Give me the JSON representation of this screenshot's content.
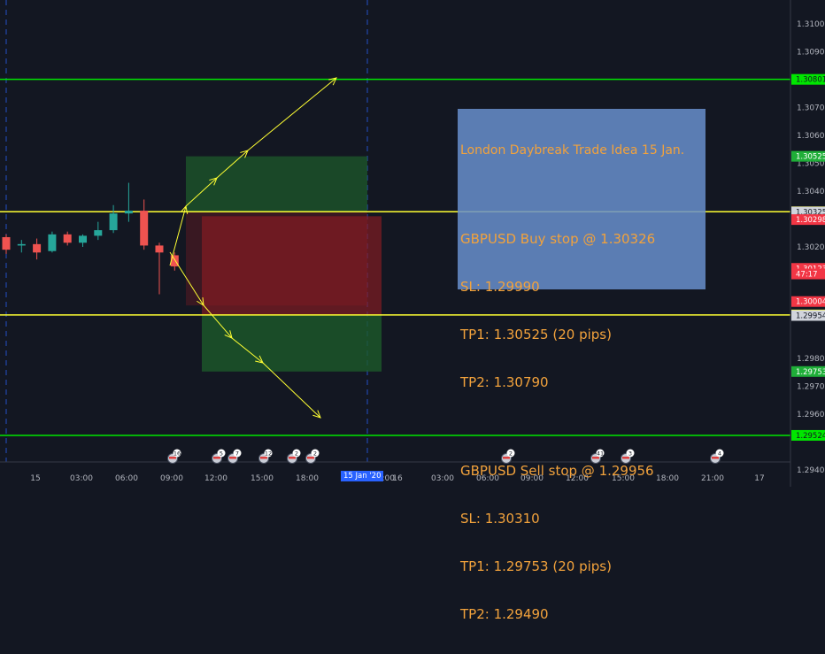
{
  "chart_data": {
    "type": "candlestick",
    "symbol": "GBPUSD",
    "ylim": [
      1.2935,
      1.312
    ],
    "y_ticks": [
      "1.31000",
      "1.30900",
      "1.30700",
      "1.30600",
      "1.30500",
      "1.30400",
      "1.30200",
      "1.29800",
      "1.29700",
      "1.29600",
      "1.29400"
    ],
    "x_ticks": [
      "15",
      "03:00",
      "06:00",
      "09:00",
      "12:00",
      "15:00",
      "18:00",
      "15 Jan '20",
      "22:00",
      "16",
      "03:00",
      "06:00",
      "09:00",
      "12:00",
      "15:00",
      "18:00",
      "21:00",
      "17"
    ],
    "candles": [
      {
        "t": 0,
        "o": 1.30235,
        "h": 1.30245,
        "l": 1.30175,
        "c": 1.3019
      },
      {
        "t": 1,
        "o": 1.30205,
        "h": 1.30225,
        "l": 1.3018,
        "c": 1.3021
      },
      {
        "t": 2,
        "o": 1.3021,
        "h": 1.3023,
        "l": 1.30155,
        "c": 1.3018
      },
      {
        "t": 3,
        "o": 1.30185,
        "h": 1.30255,
        "l": 1.3018,
        "c": 1.30245
      },
      {
        "t": 4,
        "o": 1.30245,
        "h": 1.30255,
        "l": 1.30205,
        "c": 1.30215
      },
      {
        "t": 5,
        "o": 1.30215,
        "h": 1.30245,
        "l": 1.302,
        "c": 1.3024
      },
      {
        "t": 6,
        "o": 1.3024,
        "h": 1.3029,
        "l": 1.30225,
        "c": 1.3026
      },
      {
        "t": 7,
        "o": 1.3026,
        "h": 1.3035,
        "l": 1.3025,
        "c": 1.3032
      },
      {
        "t": 8,
        "o": 1.3032,
        "h": 1.3043,
        "l": 1.3029,
        "c": 1.3033
      },
      {
        "t": 9,
        "o": 1.3033,
        "h": 1.3037,
        "l": 1.3019,
        "c": 1.30205
      },
      {
        "t": 10,
        "o": 1.30205,
        "h": 1.30215,
        "l": 1.3003,
        "c": 1.3018
      },
      {
        "t": 11,
        "o": 1.3017,
        "h": 1.3018,
        "l": 1.30115,
        "c": 1.3013
      }
    ],
    "horizontal_levels": [
      {
        "price": 1.30801,
        "label": "1.30801",
        "color": "#00e600"
      },
      {
        "price": 1.30326,
        "label": "1.30326",
        "color": "#ffff33"
      },
      {
        "price": 1.29956,
        "label": "1.29956",
        "color": "#ffff33"
      },
      {
        "price": 1.29524,
        "label": "1.29524",
        "color": "#00e600"
      }
    ],
    "price_labels": [
      {
        "price": 1.30525,
        "label": "1.30525",
        "bg": "#1fae38",
        "fg": "#ffffff"
      },
      {
        "price": 1.30325,
        "label": "1.30325",
        "bg": "#d1d4dc",
        "fg": "#131722"
      },
      {
        "price": 1.30298,
        "label": "1.30298",
        "bg": "#f23645",
        "fg": "#ffffff"
      },
      {
        "price": 1.30123,
        "label": "1.30123",
        "bg": "#f23645",
        "fg": "#ffffff"
      },
      {
        "price": 1.30103,
        "label": "47:17",
        "bg": "#f23645",
        "fg": "#ffffff"
      },
      {
        "price": 1.30004,
        "label": "1.30004",
        "bg": "#f23645",
        "fg": "#ffffff"
      },
      {
        "price": 1.29954,
        "label": "1.29954",
        "bg": "#d1d4dc",
        "fg": "#131722"
      },
      {
        "price": 1.29753,
        "label": "1.29753",
        "bg": "#1fae38",
        "fg": "#ffffff"
      }
    ],
    "events": [
      "16",
      "5",
      "7",
      "12",
      "2",
      "2",
      "2",
      "41",
      "3",
      "4"
    ],
    "colors": {
      "up": "#26a69a",
      "down": "#ef5350",
      "background": "#131722",
      "arrow": "#ffff33"
    }
  },
  "note": {
    "title": "London Daybreak Trade Idea 15 Jan.",
    "buy_line": "GBPUSD Buy stop @ 1.30326",
    "buy_sl": "SL: 1.29990",
    "buy_tp1": "TP1: 1.30525 (20 pips)",
    "buy_tp2": "TP2: 1.30790",
    "sell_line": "GBPUSD Sell stop @ 1.29956",
    "sell_sl": "SL: 1.30310",
    "sell_tp1": "TP1: 1.29753 (20 pips)",
    "sell_tp2": "TP2: 1.29490"
  },
  "time_label": "15 Jan '20"
}
